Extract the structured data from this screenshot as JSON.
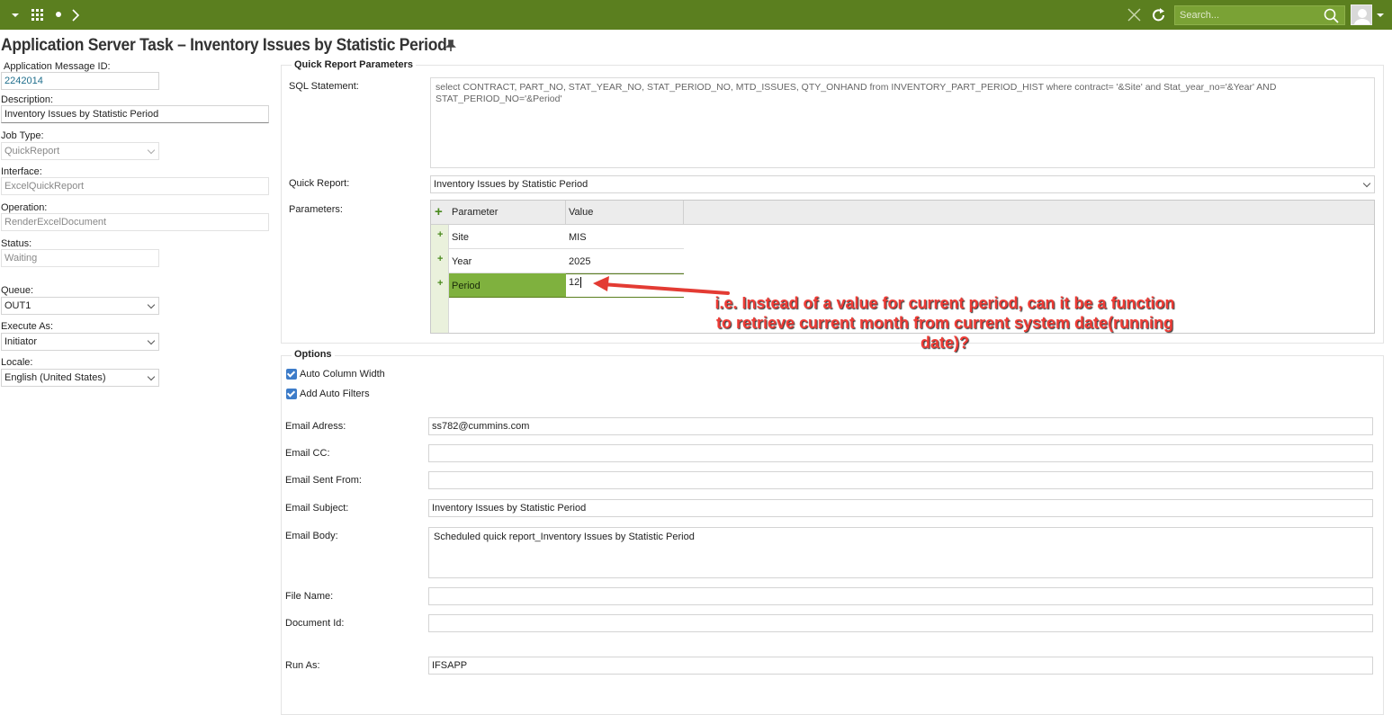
{
  "topbar": {
    "search_placeholder": "Search...",
    "icons": [
      "caret-down-icon",
      "apps-grid-icon",
      "dot-icon",
      "chevron-right-icon",
      "close-icon",
      "refresh-icon",
      "search-icon",
      "user-avatar-icon",
      "caret-down-icon"
    ],
    "bar_color": "#5b7f1f"
  },
  "page": {
    "title": "Application Server Task – Inventory Issues by Statistic Period"
  },
  "left": {
    "msg_id_label": "Application Message ID:",
    "msg_id_value": "2242014",
    "desc_label": "Description:",
    "desc_value": "Inventory Issues by Statistic Period",
    "jobtype_label": "Job Type:",
    "jobtype_value": "QuickReport",
    "interface_label": "Interface:",
    "interface_value": "ExcelQuickReport",
    "operation_label": "Operation:",
    "operation_value": "RenderExcelDocument",
    "status_label": "Status:",
    "status_value": "Waiting",
    "queue_label": "Queue:",
    "queue_value": "OUT1",
    "execas_label": "Execute As:",
    "execas_value": "Initiator",
    "locale_label": "Locale:",
    "locale_value": "English (United States)"
  },
  "qrp": {
    "group_title": "Quick Report Parameters",
    "sql_label": "SQL Statement:",
    "sql_value": "select CONTRACT, PART_NO,  STAT_YEAR_NO, STAT_PERIOD_NO, MTD_ISSUES, QTY_ONHAND  from INVENTORY_PART_PERIOD_HIST where contract= '&Site' and Stat_year_no='&Year' AND STAT_PERIOD_NO='&Period'",
    "qr_label": "Quick Report:",
    "qr_value": "Inventory Issues by Statistic Period",
    "params_label": "Parameters:",
    "col_parameter": "Parameter",
    "col_value": "Value",
    "rows": [
      {
        "param": "Site",
        "value": "MIS"
      },
      {
        "param": "Year",
        "value": "2025"
      },
      {
        "param": "Period",
        "value": "12"
      }
    ]
  },
  "annotation": "i.e. Instead of a value for current period, can it be a function to retrieve current month from current system date(running date)?",
  "options": {
    "group_title": "Options",
    "auto_col_width": "Auto Column Width",
    "add_auto_filters": "Add Auto Filters",
    "email_address_label": "Email Adress:",
    "email_address_value": "ss782@cummins.com",
    "email_cc_label": "Email CC:",
    "email_cc_value": "",
    "email_from_label": "Email Sent From:",
    "email_from_value": "",
    "email_subject_label": "Email Subject:",
    "email_subject_value": "Inventory Issues by Statistic Period",
    "email_body_label": "Email Body:",
    "email_body_value": "Scheduled quick report_Inventory Issues by Statistic Period",
    "file_name_label": "File Name:",
    "file_name_value": "",
    "doc_id_label": "Document Id:",
    "doc_id_value": "",
    "run_as_label": "Run As:",
    "run_as_value": "IFSAPP"
  }
}
